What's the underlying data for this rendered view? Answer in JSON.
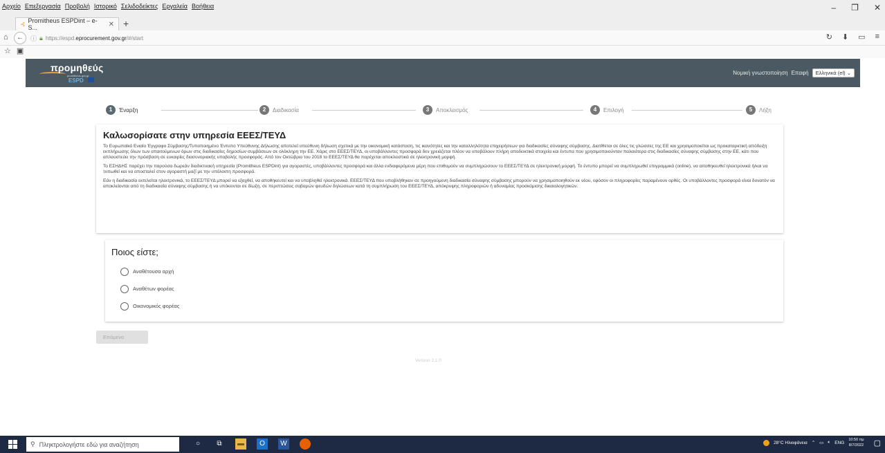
{
  "browser": {
    "menu": [
      "Αρχείο",
      "Επεξεργασία",
      "Προβολή",
      "Ιστορικό",
      "Σελιδοδείκτες",
      "Εργαλεία",
      "Βοήθεια"
    ],
    "tab_title": "Promitheus ESPDint – e-S...",
    "url_prefix": "https://espd.",
    "url_domain": "eprocurement.gov.gr",
    "url_suffix": "/#/start"
  },
  "site": {
    "logo_text": "προμηθεύς",
    "logo_small": "promitheus.gov.gr",
    "logo_espd": "ESPD",
    "legal_link": "Νομική γνωστοποίηση",
    "contact_link": "Επαφή",
    "language": "Ελληνικά (el)"
  },
  "steps": [
    {
      "num": "1",
      "label": "Έναρξη"
    },
    {
      "num": "2",
      "label": "Διαδικασία"
    },
    {
      "num": "3",
      "label": "Αποκλεισμός"
    },
    {
      "num": "4",
      "label": "Επιλογή"
    },
    {
      "num": "5",
      "label": "Λήξη"
    }
  ],
  "welcome": {
    "title": "Καλωσορίσατε στην υπηρεσία ΕΕΕΣ/ΤΕΥΔ",
    "p1": "Το Ευρωπαϊκό Ενιαίο Έγγραφο Σύμβασης/Τυποποιημένο Έντυπο Υπεύθυνης Δήλωσης αποτελεί υπεύθυνη δήλωση σχετικά με την οικονομική κατάσταση, τις ικανότητες και την καταλληλότητα επιχειρήσεων για διαδικασίες σύναψης σύμβασης. Διατίθεται σε όλες τις γλώσσες της ΕΕ και χρησιμοποιείται ως προκαταρκτική απόδειξη εκπλήρωσης όλων των απαιτούμενων όρων στις διαδικασίες δημοσίων συμβάσεων σε ολόκληρη την ΕΕ. Χάρις στο ΕΕΕΣ/ΤΕΥΔ, οι υποβάλλοντες προσφορά δεν χρειάζεται πλέον να υποβάλουν πλήρη αποδεικτικά στοιχεία και έντυπα που χρησιμοποιούνταν παλαιότερα στις διαδικασίες σύναψης σύμβασης στην ΕΕ, κάτι που απλουστεύει την πρόσβαση σε ευκαιρίες διασυνοριακής υποβολής προσφοράς. Από τον Οκτώβριο του 2018 το ΕΕΕΣ/ΤΕΥΔ θα παρέχεται αποκλειστικά σε ηλεκτρονική μορφή.",
    "p2": "Το ΕΣΗΔΗΣ παρέχει την παρούσα δωρεάν διαδικτυακή υπηρεσία (Promitheus ESPDint) για αγοραστές, υποβάλλοντες προσφορά και άλλα ενδιαφερόμενα μέρη που επιθυμούν να συμπληρώσουν το ΕΕΕΣ/ΤΕΥΔ σε ηλεκτρονική μορφή. Το έντυπο μπορεί να συμπληρωθεί επιγραμμικά (online), να αποθηκευθεί ηλεκτρονικά ή/και να τυπωθεί και να αποσταλεί στον αγοραστή μαζί με την υπόλοιπη προσφορά.",
    "p3": "Εάν η διαδικασία εκτελείται ηλεκτρονικά, το ΕΕΕΣ/ΤΕΥΔ μπορεί να εξαχθεί, να αποθηκευτεί και να υποβληθεί ηλεκτρονικά. ΕΕΕΣ/ΤΕΥΔ που υποβλήθηκαν σε προηγούμενη διαδικασία σύναψης σύμβασης μπορούν να χρησιμοποιηθούν εκ νέου, εφόσον οι πληροφορίες παραμένουν ορθές. Οι υποβάλλοντες προσφορά είναι δυνατόν να αποκλείονται από τη διαδικασία σύναψης σύμβασης ή να υπόκεινται σε δίωξη, σε περιπτώσεις σοβαρών ψευδών δηλώσεων κατά τη συμπλήρωση του ΕΕΕΣ/ΤΕΥΔ, απόκρυψης πληροφοριών ή αδυναμίας προσκόμισης δικαιολογητικών."
  },
  "who": {
    "title": "Ποιος είστε;",
    "options": [
      "Αναθέτουσα αρχή",
      "Αναθέτων φορέας",
      "Οικονομικός φορέας"
    ]
  },
  "next_button": "Επόμενο",
  "version": "Version 2.1.0",
  "taskbar": {
    "search_placeholder": "Πληκτρολογήστε εδώ για αναζήτηση",
    "weather": "28°C Ηλιοφάνεια",
    "lang": "ENG",
    "time": "10:50 πμ",
    "date": "8/7/2022"
  }
}
